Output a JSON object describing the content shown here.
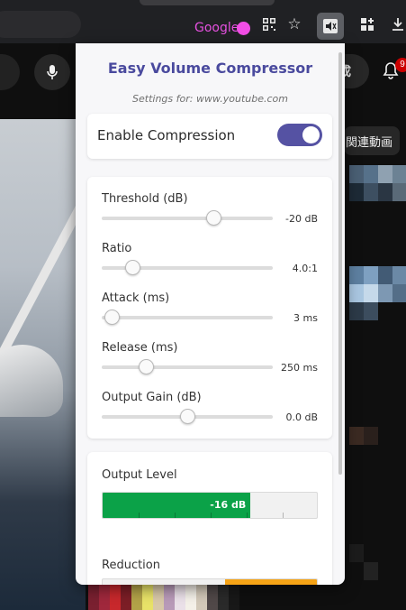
{
  "toolbar": {
    "profile_label": "Google",
    "icons": [
      "qr-code-icon",
      "bookmark-star-icon",
      "extension-icon",
      "extensions-puzzle-icon",
      "download-icon"
    ]
  },
  "youtube": {
    "create_label": "成",
    "notification_count": "9",
    "related_chip": "関連動画"
  },
  "popup": {
    "title": "Easy Volume Compressor",
    "subtitle": "Settings for: www.youtube.com",
    "enable_label": "Enable Compression",
    "enabled": true,
    "settings": [
      {
        "label": "Threshold (dB)",
        "value": "-20 dB",
        "level": 0.65
      },
      {
        "label": "Ratio",
        "value": "4.0:1",
        "level": 0.18
      },
      {
        "label": "Attack (ms)",
        "value": "3 ms",
        "level": 0.06
      },
      {
        "label": "Release (ms)",
        "value": "250 ms",
        "level": 0.26
      },
      {
        "label": "Output Gain (dB)",
        "value": "0.0 dB",
        "level": 0.5
      }
    ],
    "output_level_label": "Output Level",
    "output_level_value": "-16 dB",
    "output_level_fill": 0.69,
    "reduction_label": "Reduction",
    "reduction_fill": 0.43,
    "colors": {
      "accent": "#5552a3",
      "title": "#4a4a9e",
      "meter_green": "#0ba248",
      "reduction_orange": "#f5a316"
    }
  }
}
